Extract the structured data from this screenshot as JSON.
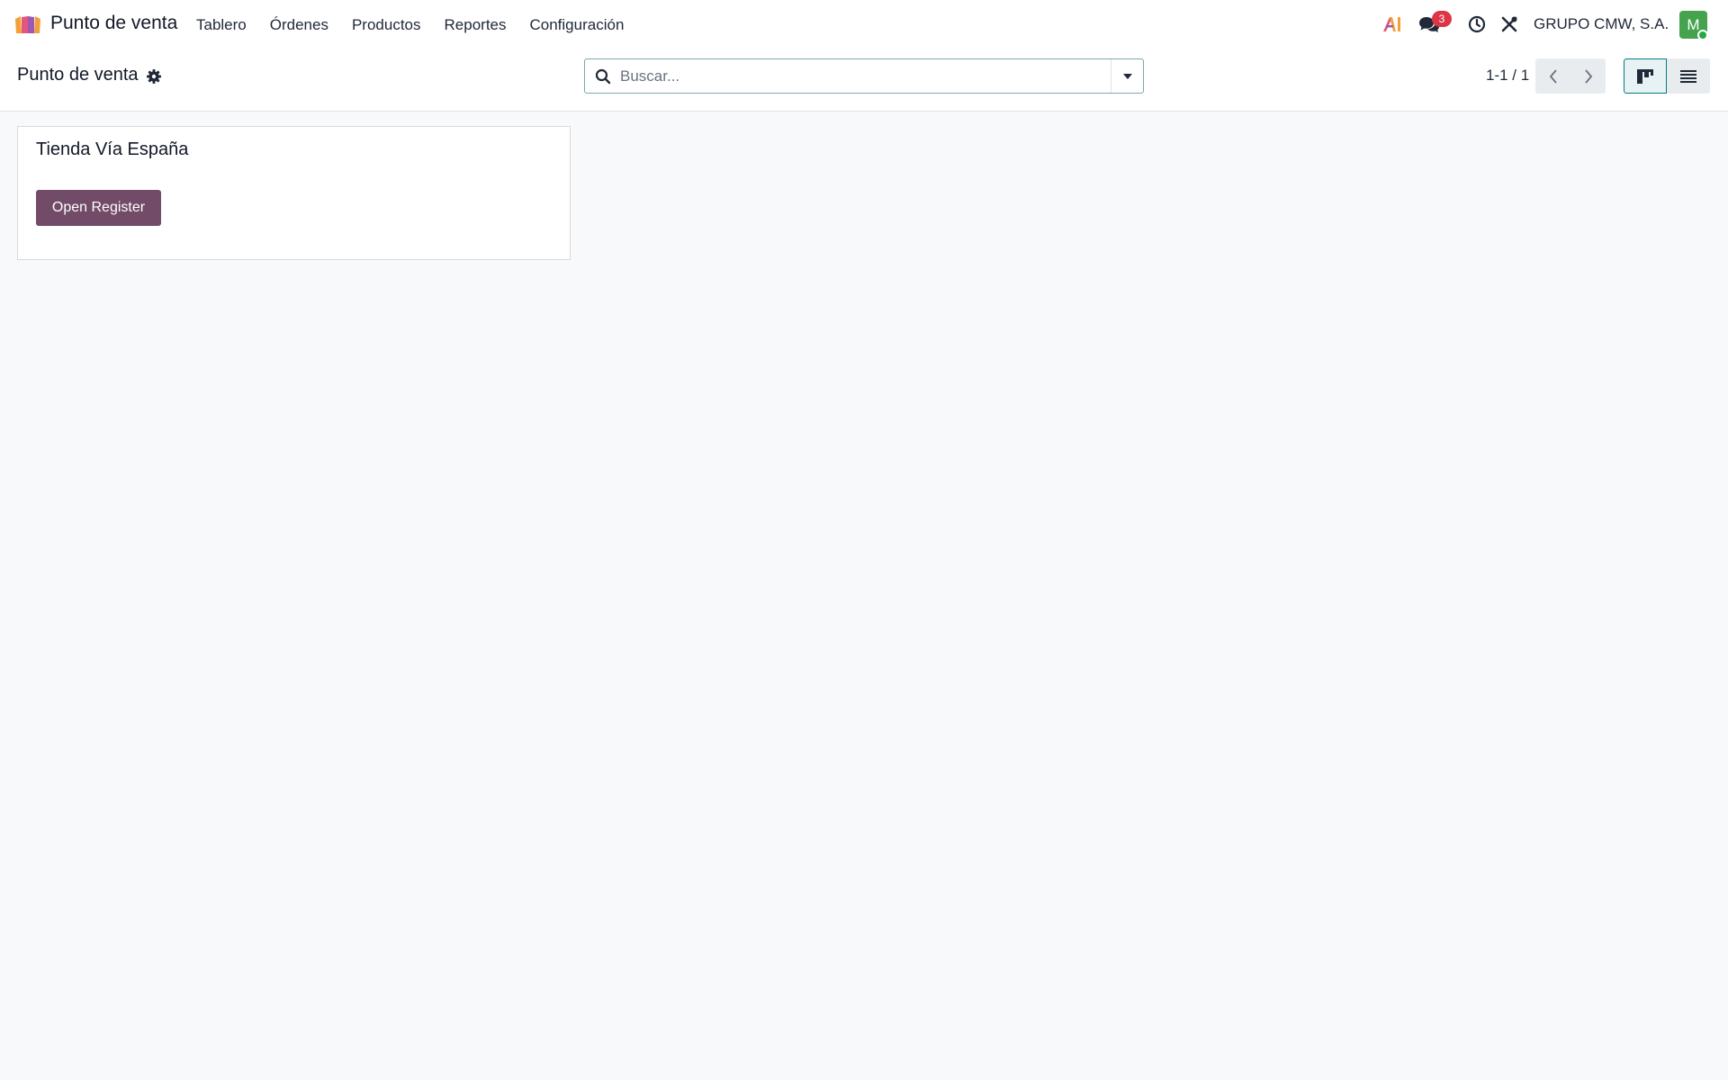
{
  "navbar": {
    "app_name": "Punto de venta",
    "menu": [
      "Tablero",
      "Órdenes",
      "Productos",
      "Reportes",
      "Configuración"
    ],
    "messages_count": "3",
    "company": "GRUPO CMW, S.A.",
    "avatar_initial": "M"
  },
  "control_panel": {
    "title": "Punto de venta",
    "search_placeholder": "Buscar...",
    "pager": "1-1 / 1"
  },
  "kanban": {
    "cards": [
      {
        "title": "Tienda Vía España",
        "button": "Open Register"
      }
    ]
  },
  "colors": {
    "brand": "#714b67",
    "accent": "#017e84",
    "badge": "#dc3545",
    "avatar": "#45a34e"
  },
  "icons": [
    "pos-app-icon",
    "ai-icon",
    "chat-icon",
    "clock-icon",
    "tools-icon",
    "gear-icon",
    "search-icon",
    "caret-down-icon",
    "chevron-left-icon",
    "chevron-right-icon",
    "kanban-view-icon",
    "list-view-icon"
  ]
}
